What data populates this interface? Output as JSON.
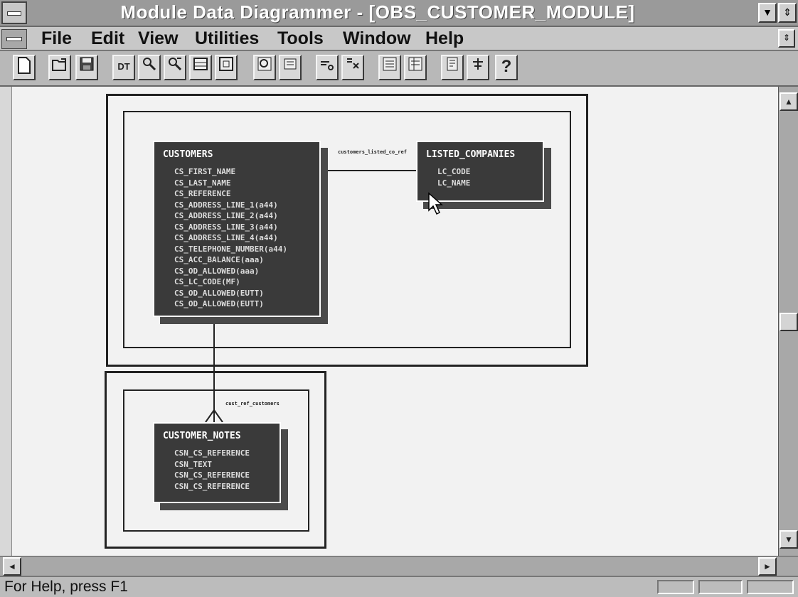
{
  "window": {
    "title": "Module Data Diagrammer - [OBS_CUSTOMER_MODULE]",
    "minimize_glyph": "▼",
    "maximize_glyph": "⇕",
    "restore_glyph": "⇕"
  },
  "menu": {
    "items": [
      "File",
      "Edit",
      "View",
      "Utilities",
      "Tools",
      "Window",
      "Help"
    ]
  },
  "toolbar": {
    "buttons": [
      "new-icon",
      "open-icon",
      "save-icon",
      "dt-icon",
      "find-icon",
      "find-next-icon",
      "grid-icon",
      "table-icon",
      "zoom-in-icon",
      "zoom-out-icon",
      "link-icon",
      "relationship-icon",
      "list-icon",
      "columns-icon",
      "properties-icon",
      "tools-icon",
      "help-icon"
    ],
    "dt_label": "DT",
    "help_label": "?"
  },
  "diagram": {
    "entities": [
      {
        "name": "CUSTOMERS",
        "columns": [
          "CS_FIRST_NAME",
          "CS_LAST_NAME",
          "CS_REFERENCE",
          "CS_ADDRESS_LINE_1(a44)",
          "CS_ADDRESS_LINE_2(a44)",
          "CS_ADDRESS_LINE_3(a44)",
          "CS_ADDRESS_LINE_4(a44)",
          "CS_TELEPHONE_NUMBER(a44)",
          "CS_ACC_BALANCE(aaa)",
          "CS_OD_ALLOWED(aaa)",
          "CS_LC_CODE(MF)",
          "CS_OD_ALLOWED(EUTT)",
          "CS_OD_ALLOWED(EUTT)"
        ]
      },
      {
        "name": "LISTED_COMPANIES",
        "columns": [
          "LC_CODE",
          "LC_NAME"
        ]
      },
      {
        "name": "CUSTOMER_NOTES",
        "columns": [
          "CSN_CS_REFERENCE",
          "CSN_TEXT",
          "CSN_CS_REFERENCE",
          "CSN_CS_REFERENCE"
        ]
      }
    ],
    "relationships": [
      {
        "label": "customers_listed_co_ref"
      },
      {
        "label": "cust_ref_customers"
      }
    ]
  },
  "scrollbars": {
    "up_glyph": "▲",
    "down_glyph": "▼",
    "left_glyph": "◄",
    "right_glyph": "►"
  },
  "status": {
    "text": "For Help, press F1"
  }
}
